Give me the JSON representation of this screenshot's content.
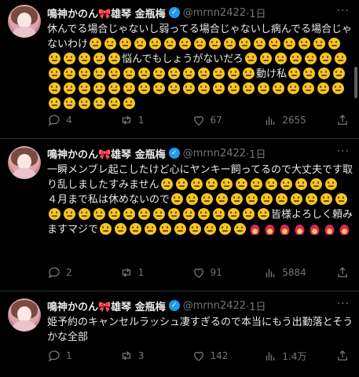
{
  "tweets": [
    {
      "name": "鳴神かのん🎀雄琴 金瓶梅",
      "handle": "@mrnn2422",
      "time": "·1日",
      "text_parts": [
        {
          "t": "休んでる場合じゃないし弱ってる場合じゃないし病んでる場合じゃないわけ"
        },
        {
          "e": "grin",
          "n": 10
        },
        {
          "e": "grin",
          "n": 12
        },
        {
          "t": "悩んでもしょうがないだろ"
        },
        {
          "e": "grin",
          "n": 2
        },
        {
          "e": "grin",
          "n": 17
        },
        {
          "e": "grin",
          "n": 2
        },
        {
          "t": "動け私"
        },
        {
          "e": "grin",
          "n": 13
        },
        {
          "e": "grin",
          "n": 17
        }
      ],
      "replies": "4",
      "reposts": "1",
      "likes": "67",
      "views": "2655"
    },
    {
      "name": "鳴神かのん🎀雄琴 金瓶梅",
      "handle": "@mrnn2422",
      "time": "·1日",
      "text_parts": [
        {
          "t": "一瞬メンブレ起こしたけど心にヤンキー飼ってるので大丈夫です取り乱しましたすみません"
        },
        {
          "e": "grin",
          "n": 12
        },
        {
          "br": true
        },
        {
          "t": "４月まで私は休めないので"
        },
        {
          "e": "grin",
          "n": 10
        },
        {
          "e": "grin",
          "n": 17
        },
        {
          "t": "皆様よろしく頼みますマジで"
        },
        {
          "e": "grin",
          "n": 10
        },
        {
          "e": "fire",
          "n": 7
        }
      ],
      "replies": "2",
      "reposts": "1",
      "likes": "91",
      "views": "5884"
    },
    {
      "name": "鳴神かのん🎀雄琴 金瓶梅",
      "handle": "@mrnn2422",
      "time": "·1日",
      "text_parts": [
        {
          "t": "姫予約のキャンセルラッシュ凄すぎるので本当にもう出勤落とそうかな全部"
        }
      ],
      "replies": "1",
      "reposts": "3",
      "likes": "142",
      "views": "1.4万"
    }
  ],
  "icons": {
    "more": "more-dots-icon",
    "reply": "reply-bubble-icon",
    "repost": "repost-arrows-icon",
    "like": "heart-icon",
    "views": "views-bars-icon",
    "share": "share-upload-icon",
    "verified": "verified-badge-icon"
  },
  "colors": {
    "background": "#000000",
    "text": "#e7e9ea",
    "muted": "#71767b",
    "verified": "#1d9bf0",
    "divider": "#2f3336"
  }
}
